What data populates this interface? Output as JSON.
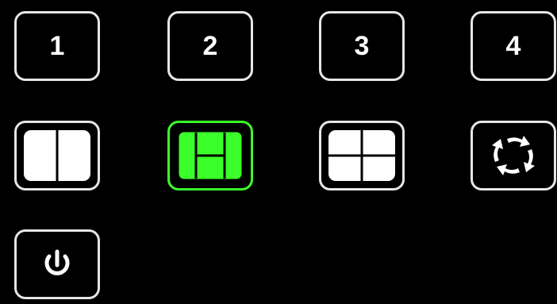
{
  "buttons": {
    "screen1": "1",
    "screen2": "2",
    "screen3": "3",
    "screen4": "4"
  },
  "layouts": [
    {
      "name": "split-two",
      "icon": "split-vertical-icon",
      "active": false
    },
    {
      "name": "picture-in-picture",
      "icon": "pip-layout-icon",
      "active": true
    },
    {
      "name": "quad",
      "icon": "quad-split-icon",
      "active": false
    },
    {
      "name": "cycle",
      "icon": "refresh-cycle-icon",
      "active": false
    }
  ],
  "power": {
    "icon": "power-icon"
  },
  "colors": {
    "background": "#000000",
    "border": "#e6e6e6",
    "active": "#3aff2a",
    "icon": "#ffffff"
  }
}
